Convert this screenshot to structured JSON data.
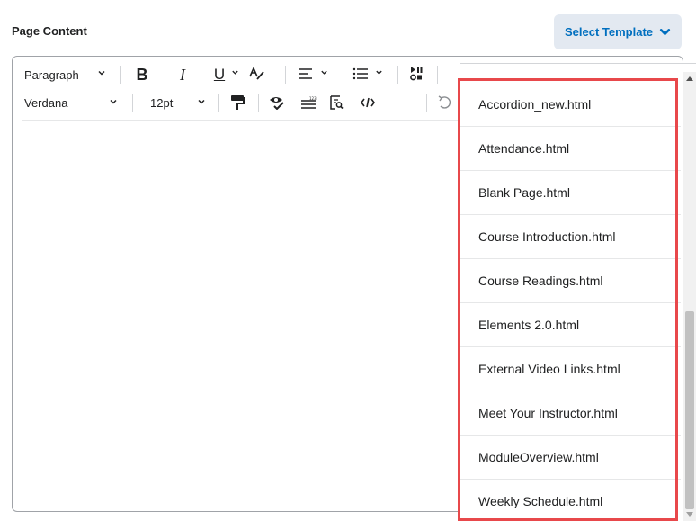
{
  "page": {
    "title": "Page Content"
  },
  "select_template": {
    "label": "Select Template"
  },
  "toolbar": {
    "format_block": "Paragraph",
    "font_family": "Verdana",
    "font_size": "12pt",
    "icons": [
      "bold-icon",
      "italic-icon",
      "underline-icon",
      "text-color-icon",
      "align-icon",
      "list-icon",
      "insert-media-icon",
      "format-painter-icon",
      "accessibility-icon",
      "word-count-icon",
      "preview-icon",
      "source-code-icon",
      "undo-icon"
    ]
  },
  "dropdown": {
    "items": [
      "Accordion_new.html",
      "Attendance.html",
      "Blank Page.html",
      "Course Introduction.html",
      "Course Readings.html",
      "Elements 2.0.html",
      "External Video Links.html",
      "Meet Your Instructor.html",
      "ModuleOverview.html",
      "Weekly Schedule.html"
    ]
  },
  "colors": {
    "accent": "#006fbf",
    "button_bg": "#e3e9f1",
    "highlight": "#e8484b"
  }
}
